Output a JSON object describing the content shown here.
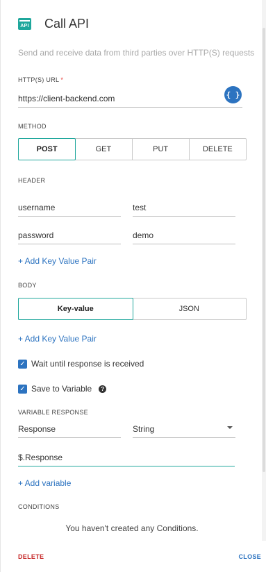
{
  "header": {
    "icon_text": "API",
    "title": "Call API",
    "subtitle": "Send and receive data from third parties over HTTP(S) requests"
  },
  "url": {
    "label": "HTTP(S) URL",
    "required_mark": "*",
    "value": "https://client-backend.com",
    "code_button_icon": "code-braces-icon",
    "code_button_glyph": "{ }"
  },
  "method": {
    "label": "METHOD",
    "options": [
      "POST",
      "GET",
      "PUT",
      "DELETE"
    ],
    "selected": "POST"
  },
  "header_section": {
    "label": "HEADER",
    "pairs": [
      {
        "key": "username",
        "value": "test"
      },
      {
        "key": "password",
        "value": "demo"
      }
    ],
    "add_link": "+ Add Key Value Pair"
  },
  "body": {
    "label": "BODY",
    "options": [
      "Key-value",
      "JSON"
    ],
    "selected": "Key-value",
    "add_link": "+ Add Key Value Pair"
  },
  "options": {
    "wait_label": "Wait until response is received",
    "wait_checked": true,
    "save_label": "Save to Variable",
    "save_checked": true,
    "help_glyph": "?"
  },
  "variable_response": {
    "label": "VARIABLE RESPONSE",
    "name": "Response",
    "type": "String",
    "path": "$.Response",
    "add_link": "+ Add variable"
  },
  "conditions": {
    "label": "CONDITIONS",
    "empty_message": "You haven't created any Conditions."
  },
  "footer": {
    "delete_label": "DELETE",
    "close_label": "CLOSE"
  },
  "colors": {
    "accent": "#1fa79c",
    "link": "#2c73c0",
    "danger": "#c62828"
  }
}
